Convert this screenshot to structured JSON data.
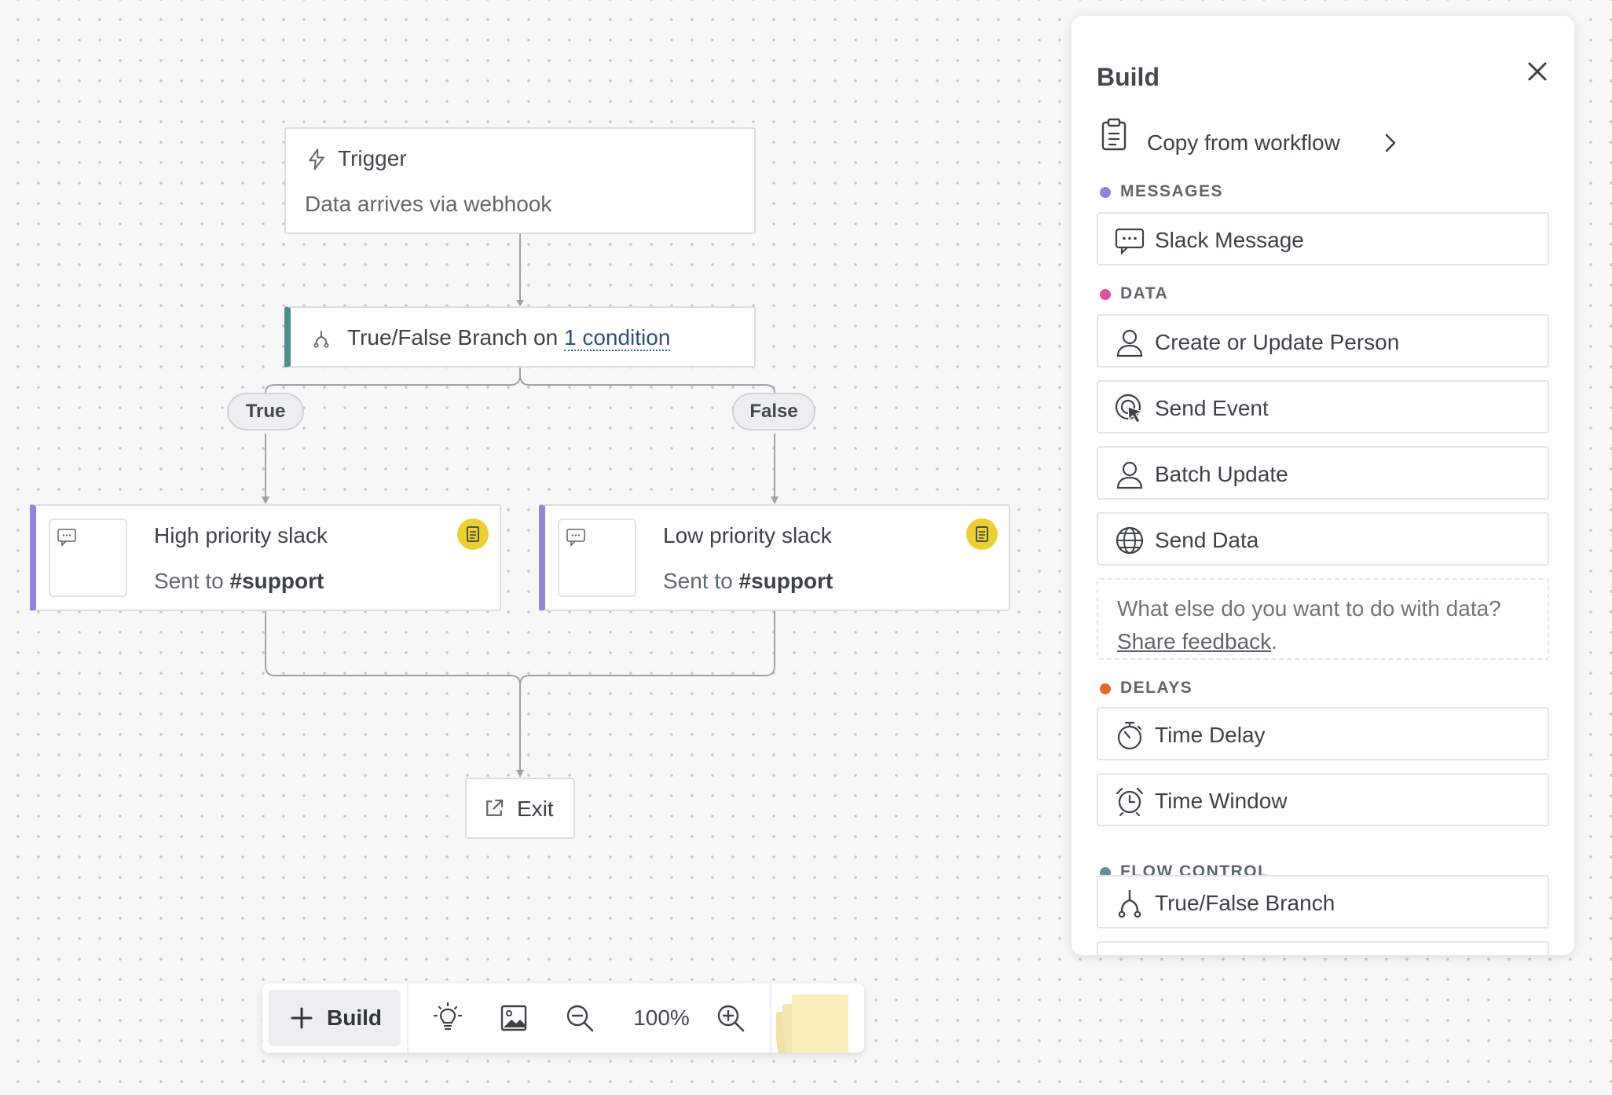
{
  "canvas": {
    "trigger": {
      "title": "Trigger",
      "subtitle": "Data arrives via webhook"
    },
    "branch": {
      "prefix": "True/False Branch on ",
      "condition": "1 condition"
    },
    "true_label": "True",
    "false_label": "False",
    "actions": [
      {
        "title": "High priority slack",
        "sent_prefix": "Sent to ",
        "channel": "#support"
      },
      {
        "title": "Low priority slack",
        "sent_prefix": "Sent to ",
        "channel": "#support"
      }
    ],
    "exit": {
      "label": "Exit"
    }
  },
  "toolbar": {
    "build_label": "Build",
    "zoom": "100%",
    "icons": [
      "plus-icon",
      "lightbulb-icon",
      "image-icon",
      "zoom-out-icon",
      "zoom-in-icon",
      "sticky-notes-icon"
    ]
  },
  "panel": {
    "title": "Build",
    "copy_from_workflow": "Copy from workflow",
    "sections": {
      "messages": {
        "label": "MESSAGES",
        "color": "#8d86d9",
        "items": [
          "Slack Message"
        ]
      },
      "data": {
        "label": "DATA",
        "color": "#e0529a",
        "items": [
          "Create or Update Person",
          "Send Event",
          "Batch Update",
          "Send Data"
        ]
      },
      "delays": {
        "label": "DELAYS",
        "color": "#e06a2c",
        "items": [
          "Time Delay",
          "Time Window"
        ]
      },
      "flow_control": {
        "label": "FLOW CONTROL",
        "color": "#5f8f95",
        "items": [
          "True/False Branch"
        ]
      }
    },
    "feedback": {
      "question": "What else do you want to do with data?",
      "link": "Share feedback",
      "suffix": "."
    }
  },
  "colors": {
    "branch_accent": "#4f8c92",
    "message_accent": "#8d86d9",
    "badge": "#eccf32"
  }
}
